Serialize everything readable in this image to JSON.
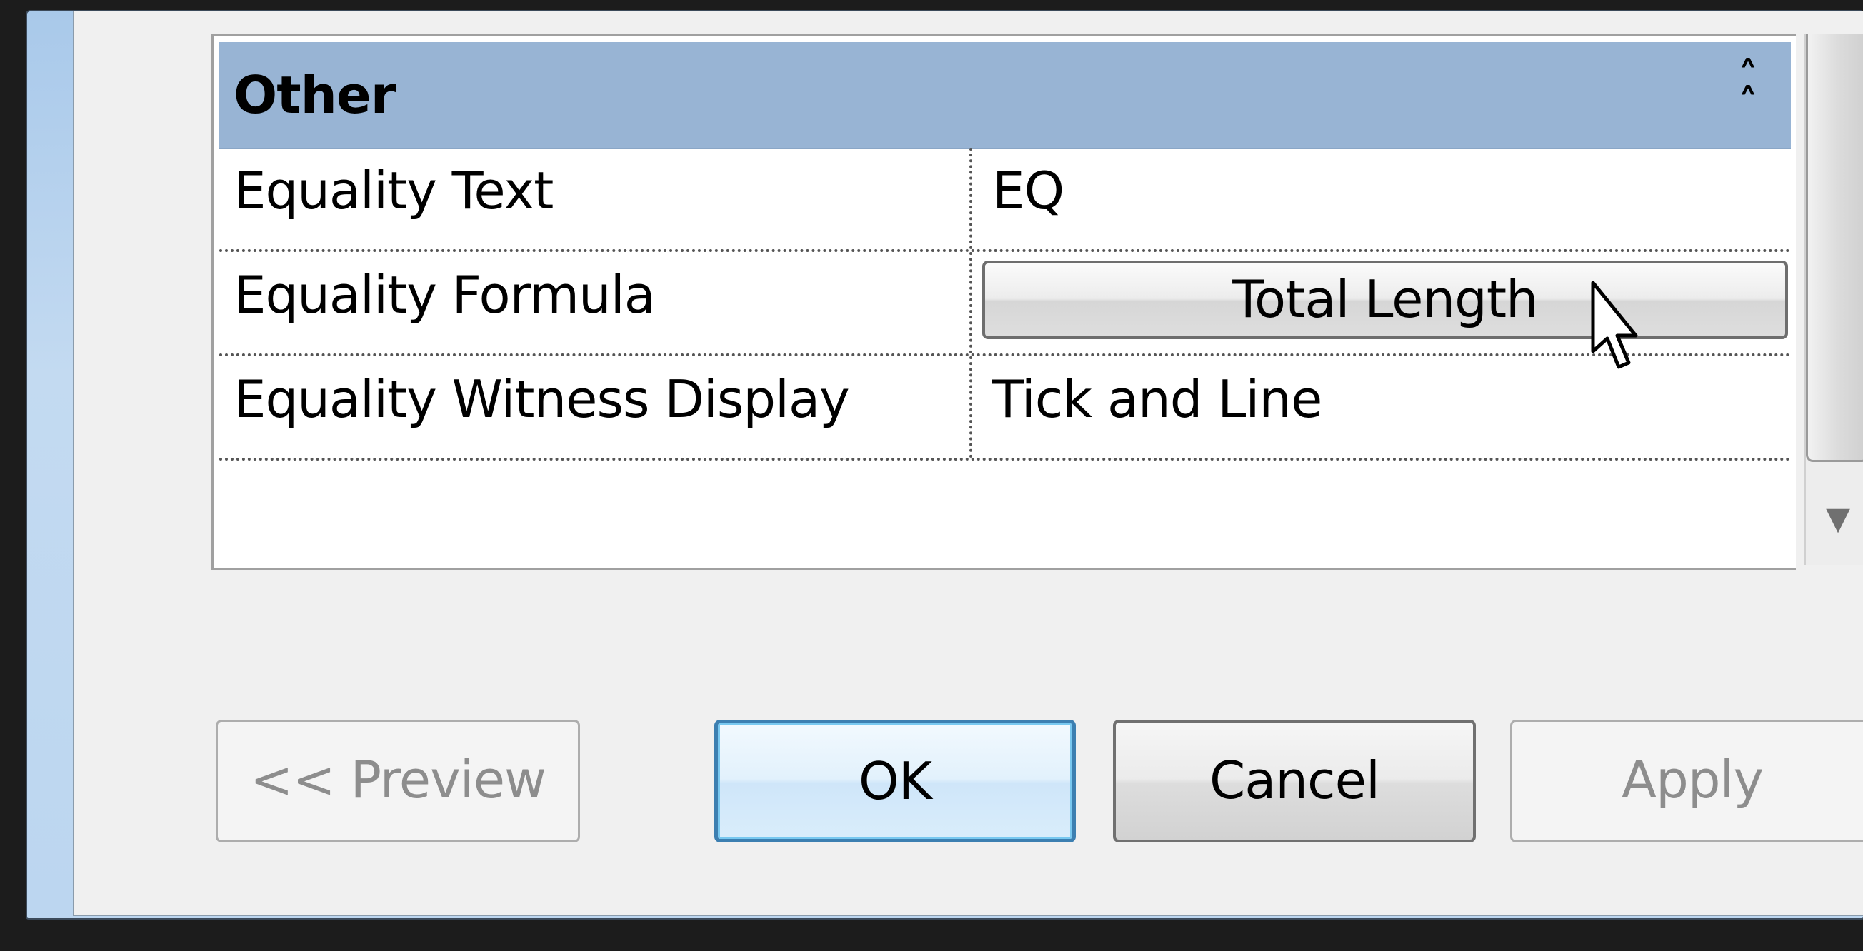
{
  "property_grid": {
    "category": {
      "label": "Other",
      "toggle_icon": "collapse-chevrons-icon"
    },
    "rows": [
      {
        "name": "Equality Text",
        "value": "EQ"
      },
      {
        "name": "Equality Formula",
        "value": "Total Length"
      },
      {
        "name": "Equality Witness Display",
        "value": "Tick and Line"
      }
    ]
  },
  "buttons": {
    "preview": "<< Preview",
    "ok": "OK",
    "cancel": "Cancel",
    "apply": "Apply"
  },
  "colors": {
    "category_header": "#98b4d4",
    "default_button_border": "#3c7fb1",
    "disabled_text": "#8d8d8d"
  }
}
